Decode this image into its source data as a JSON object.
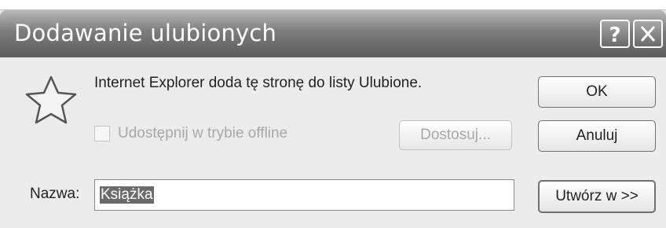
{
  "dialog": {
    "title": "Dodawanie ulubionych",
    "help_label": "?",
    "close_label": "✕"
  },
  "message": "Internet Explorer doda tę stronę do listy Ulubione.",
  "offline": {
    "label": "Udostępnij w trybie offline",
    "checked": false,
    "customize_label": "Dostosuj..."
  },
  "buttons": {
    "ok": "OK",
    "cancel": "Anuluj",
    "create_in": "Utwórz w >>"
  },
  "name_field": {
    "label": "Nazwa:",
    "value": "Książka"
  }
}
